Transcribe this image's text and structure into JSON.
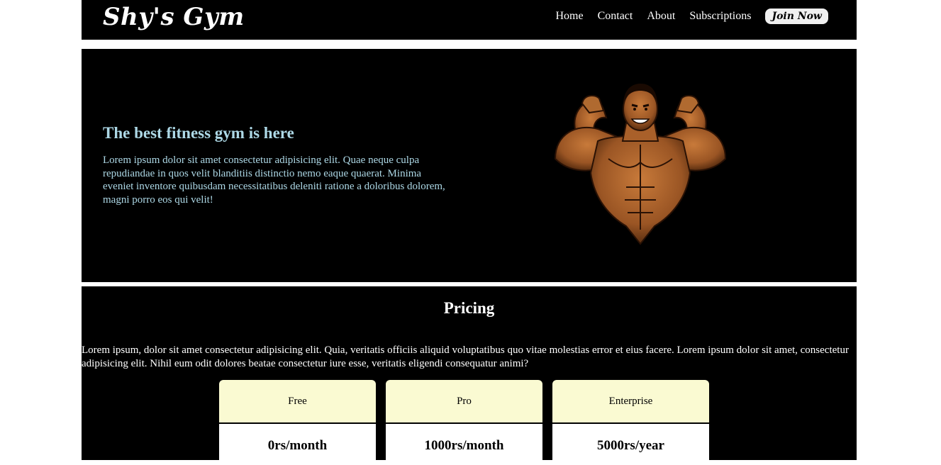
{
  "navbar": {
    "brand": "Shy's Gym",
    "links": [
      "Home",
      "Contact",
      "About",
      "Subscriptions"
    ],
    "join_label": "Join Now"
  },
  "hero": {
    "title": "The best fitness gym is here",
    "text": "Lorem ipsum dolor sit amet consectetur adipisicing elit. Quae neque culpa repudiandae in quos velit blanditiis distinctio nemo eaque quaerat. Minima eveniet inventore quibusdam necessitatibus deleniti ratione a doloribus dolorem, magni porro eos qui velit!",
    "image_icon": "bodybuilder-mascot"
  },
  "pricing": {
    "title": "Pricing",
    "text": "Lorem ipsum, dolor sit amet consectetur adipisicing elit. Quia, veritatis officiis aliquid voluptatibus quo vitae molestias error et eius facere. Lorem ipsum dolor sit amet, consectetur adipisicing elit. Nihil eum odit dolores beatae consectetur iure esse, veritatis eligendi consequatur animi?",
    "plans": [
      {
        "name": "Free",
        "price": "0rs/month"
      },
      {
        "name": "Pro",
        "price": "1000rs/month"
      },
      {
        "name": "Enterprise",
        "price": "5000rs/year"
      }
    ]
  },
  "colors": {
    "background": "#000000",
    "hero_text": "#add8e6",
    "plan_header": "#fafad2"
  }
}
